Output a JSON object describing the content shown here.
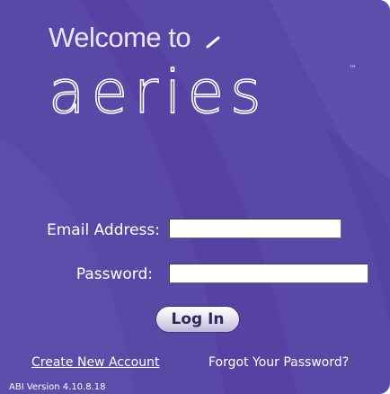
{
  "header": {
    "welcome_text": "Welcome to",
    "brand_name": "aeries",
    "trademark": "™"
  },
  "form": {
    "email_label": "Email Address:",
    "email_value": "",
    "password_label": "Password:",
    "password_value": "",
    "login_label": "Log In"
  },
  "links": {
    "create_account": "Create New Account",
    "forgot_password": "Forgot Your Password?"
  },
  "footer": {
    "version": "ABI Version 4.10.8.18"
  },
  "colors": {
    "panel_background": "#5a48a6",
    "text": "#ffffff",
    "button_text": "#2f2a55"
  }
}
